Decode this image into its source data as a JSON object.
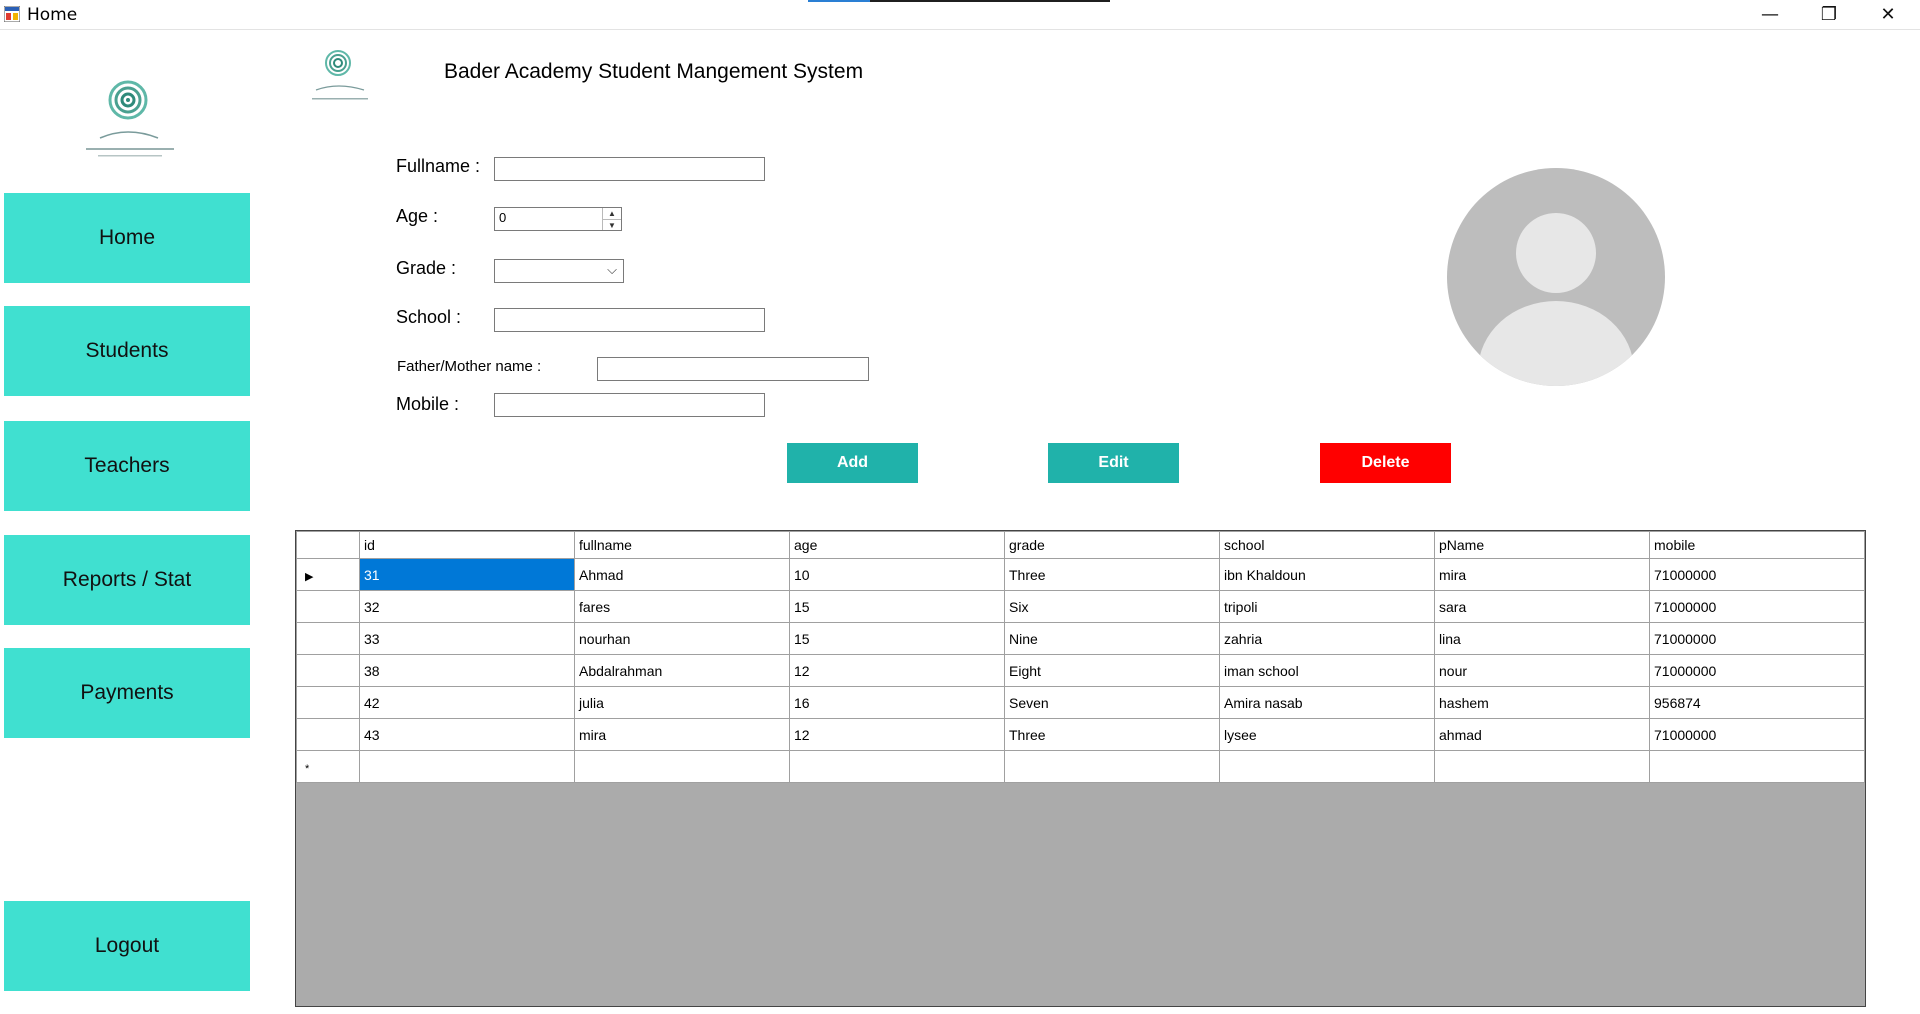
{
  "window": {
    "title": "Home",
    "minimize_glyph": "—",
    "restore_glyph": "❐",
    "close_glyph": "✕"
  },
  "sidebar": {
    "items": [
      {
        "label": "Home"
      },
      {
        "label": "Students"
      },
      {
        "label": "Teachers"
      },
      {
        "label": "Reports / Stat"
      },
      {
        "label": "Payments"
      }
    ],
    "logout_label": "Logout"
  },
  "header": {
    "title": "Bader Academy Student  Mangement System",
    "logo_icon": "bader-logo-icon"
  },
  "form": {
    "fullname_label": "Fullname :",
    "fullname_value": "",
    "age_label": "Age :",
    "age_value": "0",
    "grade_label": "Grade :",
    "grade_value": "",
    "school_label": "School :",
    "school_value": "",
    "parent_label": "Father/Mother name :",
    "parent_value": "",
    "mobile_label": "Mobile :",
    "mobile_value": ""
  },
  "actions": {
    "add_label": "Add",
    "edit_label": "Edit",
    "delete_label": "Delete"
  },
  "grid": {
    "columns": [
      "id",
      "fullname",
      "age",
      "grade",
      "school",
      "pName",
      "mobile"
    ],
    "rows": [
      {
        "id": "31",
        "fullname": "Ahmad",
        "age": "10",
        "grade": "Three",
        "school": "ibn Khaldoun",
        "pName": "mira",
        "mobile": "71000000"
      },
      {
        "id": "32",
        "fullname": "fares",
        "age": "15",
        "grade": "Six",
        "school": "tripoli",
        "pName": "sara",
        "mobile": "71000000"
      },
      {
        "id": "33",
        "fullname": "nourhan",
        "age": "15",
        "grade": "Nine",
        "school": "zahria",
        "pName": "lina",
        "mobile": "71000000"
      },
      {
        "id": "38",
        "fullname": "Abdalrahman",
        "age": "12",
        "grade": "Eight",
        "school": "iman school",
        "pName": "nour",
        "mobile": "71000000"
      },
      {
        "id": "42",
        "fullname": "julia",
        "age": "16",
        "grade": "Seven",
        "school": "Amira nasab",
        "pName": "hashem",
        "mobile": "956874"
      },
      {
        "id": "43",
        "fullname": "mira",
        "age": "12",
        "grade": "Three",
        "school": "lysee",
        "pName": "ahmad",
        "mobile": "71000000"
      }
    ],
    "current_row_marker": "▶",
    "new_row_marker": "*"
  },
  "colors": {
    "nav_accent": "#40e0d0",
    "action_teal": "#20b2aa",
    "delete_red": "#ff0000",
    "selection_blue": "#0078d7",
    "grid_empty": "#ababab"
  }
}
